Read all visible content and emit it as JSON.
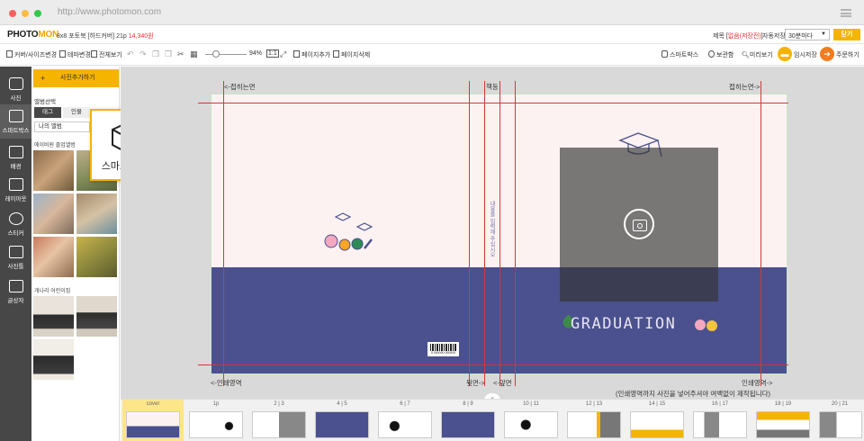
{
  "browser": {
    "url": "http://www.photomon.com",
    "dots": [
      "#fc605c",
      "#fdbc40",
      "#34c84a"
    ]
  },
  "header": {
    "logo_a": "PHOTO",
    "logo_b": "MON",
    "product": "8x8 포토북 [하드커버] 21p",
    "price": "14,340원",
    "title_label": "제목 [",
    "title_value": "없음(저장전)",
    "title_end": "]",
    "autosave_label": "자동저장",
    "autosave_value": "30분마다",
    "close_label": "닫기"
  },
  "toolbar": {
    "cover_size": "커버/사이즈변경",
    "theme_change": "테마변경",
    "full_view": "전체보기",
    "zoom_value": "94%",
    "fit_label": "1:1",
    "add_page": "페이지추가",
    "delete_page": "페이지삭제",
    "smartbox": "스마트박스",
    "storage": "보관함",
    "preview": "미리보기",
    "temp_save": "임시저장",
    "order": "주문하기"
  },
  "rail": {
    "items": [
      {
        "label": "사진",
        "icon": "camera-icon"
      },
      {
        "label": "스마트박스",
        "icon": "smartbox-icon"
      },
      {
        "label": "배경",
        "icon": "image-icon"
      },
      {
        "label": "레이아웃",
        "icon": "layout-icon"
      },
      {
        "label": "스티커",
        "icon": "heart-icon"
      },
      {
        "label": "사진틀",
        "icon": "frame-icon"
      },
      {
        "label": "글상자",
        "icon": "text-icon"
      }
    ]
  },
  "panel": {
    "add_photo": "사진추가하기",
    "album_select": "앨범선택",
    "tab_tag": "태그",
    "tab_person": "인물",
    "my_album": "나의 앨범",
    "section_1": "에이비원 졸업앨범",
    "section_2": "개나리 어린이집"
  },
  "smartbox_popup": {
    "label": "스마트박스"
  },
  "workspace": {
    "fold_left": "<-접히는면",
    "spine": "책등",
    "fold_right": "접히는면->",
    "print_left": "<-인쇄영역",
    "back_label": "뒷면->",
    "front_label": "<-앞면",
    "print_right": "인쇄영역->",
    "print_note": "(인쇄영역까지 사진을 넣어주셔야 여백없이 제작됩니다)",
    "spine_text": "내용을 입력해 주십시오",
    "grad_text": "GRADUATION",
    "barcode_num": "0 000000 000000"
  },
  "filmstrip": {
    "items": [
      "cover",
      "1p",
      "2 | 3",
      "4 | 5",
      "6 | 7",
      "8 | 9",
      "10 | 11",
      "12 | 13",
      "14 | 15",
      "16 | 17",
      "18 | 19",
      "20 | 21"
    ]
  },
  "colors": {
    "accent": "#f5b400",
    "page_pink": "#fdf2f2",
    "page_navy": "#4a518e",
    "guide_red": "#d0393b",
    "price_red": "#e8322d",
    "rail_dark": "#474747"
  }
}
